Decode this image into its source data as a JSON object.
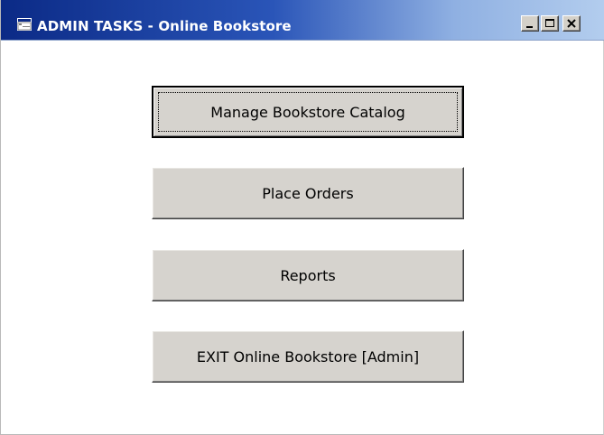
{
  "window": {
    "title": "ADMIN TASKS - Online Bookstore",
    "icon": "app-window-icon",
    "controls": {
      "minimize_icon": "minimize-icon",
      "maximize_icon": "maximize-icon",
      "close_icon": "close-icon"
    }
  },
  "buttons": {
    "manage_catalog": "Manage Bookstore Catalog",
    "place_orders": "Place Orders",
    "reports": "Reports",
    "exit": "EXIT Online Bookstore [Admin]"
  },
  "colors": {
    "titlebar_start": "#0b2a86",
    "titlebar_end": "#b3cdee",
    "button_face": "#d6d3ce",
    "client_background": "#ffffff"
  }
}
